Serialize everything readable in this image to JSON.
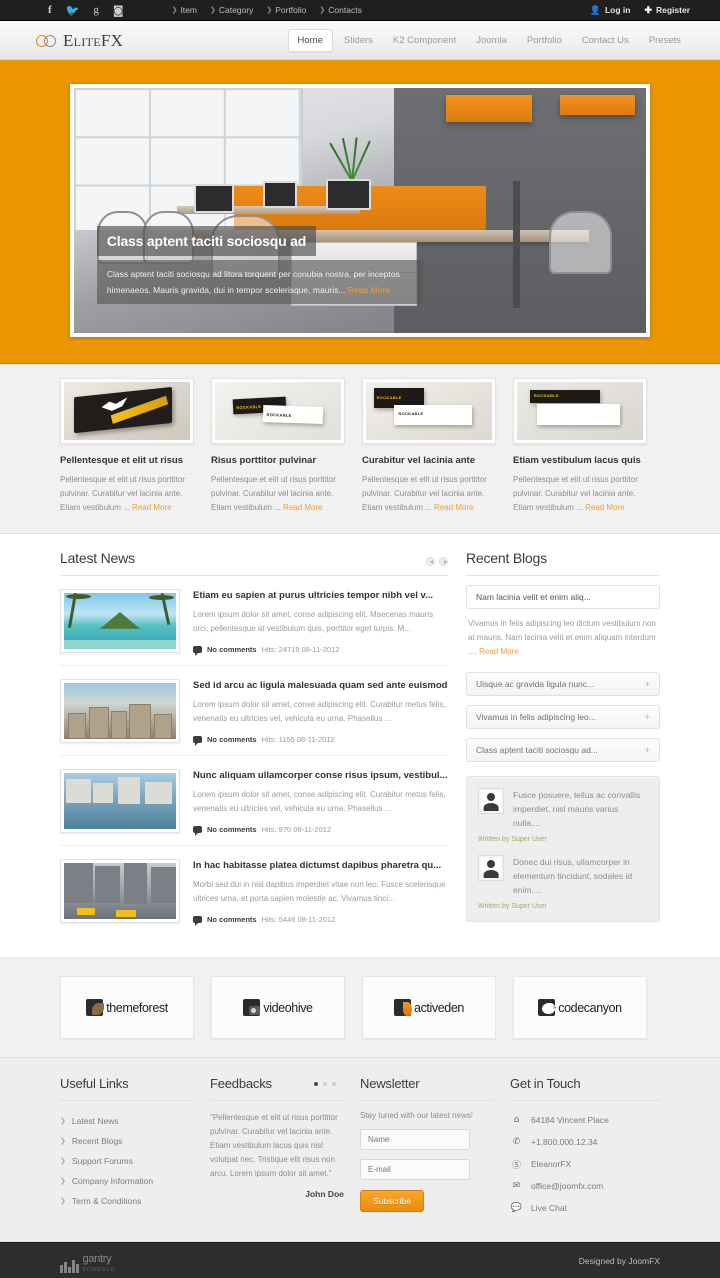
{
  "topbar": {
    "social": [
      {
        "name": "facebook-icon",
        "glyph": "f"
      },
      {
        "name": "twitter-icon",
        "glyph": "ᴠ"
      },
      {
        "name": "google-plus-icon",
        "glyph": "g"
      },
      {
        "name": "rss-icon",
        "glyph": "≋"
      }
    ],
    "nav": [
      "Item",
      "Category",
      "Portfolio",
      "Contacts"
    ],
    "login": "Log in",
    "register": "Register"
  },
  "header": {
    "logo_text": "EliteFX",
    "nav": [
      {
        "label": "Home",
        "active": true
      },
      {
        "label": "Sliders",
        "active": false
      },
      {
        "label": "K2 Component",
        "active": false
      },
      {
        "label": "Joomla",
        "active": false
      },
      {
        "label": "Portfolio",
        "active": false
      },
      {
        "label": "Contact Us",
        "active": false
      },
      {
        "label": "Presets",
        "active": false
      }
    ]
  },
  "slider": {
    "title": "Class aptent taciti sociosqu ad",
    "description": "Class aptent taciti sociosqu ad litora torquent per conubia nostra, per inceptos himenaeos. Mauris gravida, dui in tempor scelerisque, mauris...",
    "read_more": "Read More"
  },
  "features": [
    {
      "title": "Pellentesque et elit ut risus",
      "text": "Pellentesque et elit ut risus porttitor pulvinar. Curabitur vel lacinia ante. Etiam vestibulum ...",
      "read_more": "Read More"
    },
    {
      "title": "Risus porttitor pulvinar",
      "text": "Pellentesque et elit ut risus porttitor pulvinar. Curabitur vel lacinia ante. Etiam vestibulum ...",
      "read_more": "Read More"
    },
    {
      "title": "Curabitur vel lacinia ante",
      "text": "Pellentesque et elit ut risus porttitor pulvinar. Curabitur vel lacinia ante. Etiam vestibulum ...",
      "read_more": "Read More"
    },
    {
      "title": "Etiam vestibulum lacus quis",
      "text": "Pellentesque et elit ut risus porttitor pulvinar. Curabitur vel lacinia ante. Etiam vestibulum ...",
      "read_more": "Read More"
    }
  ],
  "latest_news": {
    "title": "Latest News",
    "items": [
      {
        "title": "Etiam eu sapien at purus ultricies tempor nibh vel v...",
        "text": "Lorem ipsum dolor sit amet, conse adipiscing elit. Maecenas mauris orci, pellentesque at vestibulum quis, porttitor eget turpis. M...",
        "comments": "No comments",
        "hits": "Hits: 24719 08-11-2012"
      },
      {
        "title": "Sed id arcu ac ligula malesuada quam sed ante euismod",
        "text": "Lorem ipsum dolor sit amet, conse adipiscing elit. Curabitur metus felis, venenatis eu ultricies vel, vehicula eu urna. Phasellus ...",
        "comments": "No comments",
        "hits": "Hits: 1155 08-11-2012"
      },
      {
        "title": "Nunc aliquam ullamcorper conse risus ipsum, vestibul...",
        "text": "Lorem ipsum dolor sit amet, conse adipiscing elit. Curabitur metus felis, venenatis eu ultricies vel, vehicula eu urna. Phasellus ...",
        "comments": "No comments",
        "hits": "Hits: 970 08-11-2012"
      },
      {
        "title": "In hac habitasse platea dictumst dapibus pharetra qu...",
        "text": "Morbi sed dui in nisl dapibus imperdiet vitae non leo. Fusce scelerisque ultrices urna, et porta sapien molestie ac. Vivamus tinci...",
        "comments": "No comments",
        "hits": "Hits: 5446 08-11-2012"
      }
    ]
  },
  "recent_blogs": {
    "title": "Recent Blogs",
    "open_item": {
      "label": "Nam lacinia velit et enim aliq...",
      "body": "Vivamus in felis adipiscing leo dictum vestibulum non at mauris. Nam lacinia velit et enim aliquam interdum ....",
      "read_more": "Read More"
    },
    "items": [
      {
        "label": "Uisque ac gravida ligula nunc...",
        "toggle": "+"
      },
      {
        "label": "Vivamus in felis adipiscing leo...",
        "toggle": "+"
      },
      {
        "label": "Class aptent taciti sociosqu ad...",
        "toggle": "+"
      }
    ],
    "testimonials": [
      {
        "text": "Fusce posuere, tellus ac convallis imperdiet, nisl mauris varius nulla,...",
        "by": "Written by Super User"
      },
      {
        "text": "Donec dui risus, ullamcorper in elementum tincidunt, sodales id enim....",
        "by": "Written by Super User"
      }
    ]
  },
  "brands": [
    {
      "name": "themeforest",
      "icon": "themeforest-icon"
    },
    {
      "name": "videohive",
      "icon": "videohive-icon"
    },
    {
      "name": "activeden",
      "icon": "activeden-icon"
    },
    {
      "name": "codecanyon",
      "icon": "codecanyon-icon"
    }
  ],
  "footer": {
    "useful_links": {
      "title": "Useful Links",
      "items": [
        "Latest News",
        "Recent Blogs",
        "Support Forums",
        "Company Information",
        "Term & Conditions"
      ]
    },
    "feedbacks": {
      "title": "Feedbacks",
      "quote": "\"Pellentesque et elit ut risus porttitor pulvinar. Curabitur vel lacinia ante. Etiam vestibulum lacus quis nisl volutpat nec. Tristique elit risus non arcu. Lorem ipsum dolor sit amet.\"",
      "author": "John Doe",
      "dots": 3,
      "active_dot": 0
    },
    "newsletter": {
      "title": "Newsletter",
      "note": "Stay tuned with our latest news!",
      "name_placeholder": "Name",
      "email_placeholder": "E-mail",
      "name_value": "",
      "email_value": "",
      "button": "Subscribe"
    },
    "get_in_touch": {
      "title": "Get in Touch",
      "items": [
        {
          "icon": "home-icon",
          "glyph": "⌂",
          "text": "64184 Vincent Place"
        },
        {
          "icon": "phone-icon",
          "glyph": "☎",
          "text": "+1.800.000.12.34"
        },
        {
          "icon": "skype-icon",
          "glyph": "S",
          "text": "EleanorFX"
        },
        {
          "icon": "mail-icon",
          "glyph": "✉",
          "text": "office@joomfx.com"
        },
        {
          "icon": "chat-icon",
          "glyph": "◗",
          "text": "Live Chat"
        }
      ]
    }
  },
  "copyright": {
    "gantry_text": "gantry",
    "gantry_sub": "POWERED",
    "designed_by": "Designed by JoomFX"
  },
  "colors": {
    "accent": "#eb9500",
    "readmore": "#f0a02e",
    "dark": "#1f1f1f",
    "copy_bg": "#2d2d2d"
  }
}
